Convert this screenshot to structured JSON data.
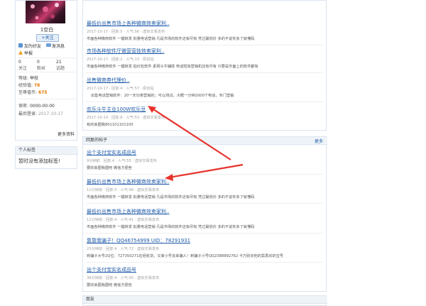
{
  "profile": {
    "username": "1空白",
    "follow_button": "+关注",
    "actions": [
      "加为好友",
      "发消息"
    ],
    "report": "举报",
    "stats": [
      {
        "value": "0",
        "label": "关注"
      },
      {
        "value": "0",
        "label": "粉丝"
      },
      {
        "value": "21",
        "label": "话题"
      }
    ],
    "level_label": "等级:",
    "level_value": "举校",
    "points_label": "经验值:",
    "points_value": "78",
    "money_label": "至尊值币:",
    "money_value": "675",
    "phone_label": "保密:",
    "phone_value": "0000-00-00",
    "last_login_label": "最后登录:",
    "last_login_value": "2017-10-17",
    "more_link": "更多资料"
  },
  "personal_tags": {
    "heading": "个人标签",
    "empty_text": "暂时没有添加标签!"
  },
  "topics": [
    {
      "title": "最低价出售市场上各种微商效卖家利..",
      "meta": "2017-10-17 · 回复:5 · 人气:56 · 虚拟交易发布",
      "summary": "市面各种微商软件 一键转发 批量电话营销 凡是市场的软件这有尽有 凭过最低价 多的不说你多了就懂码"
    },
    {
      "title": "市场各种软件厅微营营技效卖家利..",
      "meta": "2017-10-17 · 回复:2 · 人气:13 · 原创站",
      "summary": "市面各种微商软件 一键转发 拍红包软件 素网斗牛辅助 电话短信营销机应有尽有 只要是市面上的软件都有"
    },
    {
      "title": "出售微商券代理价..",
      "meta": "2017-10-17 · 回复:4 · 人气:57 · 原创站",
      "summary": "出售电话营销软件：20一天功率营销的；可以测试，大概一分钟2000个电话，专门营销"
    },
    {
      "title": "欢乐斗牛主业100W欢乐豆",
      "meta": "2017-10-14 · 回复:8 · 人气:53 · 虚拟交易发布",
      "summary": "有的来圈我801101101100"
    }
  ],
  "replies": {
    "heading": "回复的帖子",
    "more": "更多",
    "items": [
      {
        "title": "出个支付宝实名成品号",
        "meta": "9分钟前 · 回复:4 · 人气:55 · 虚拟交易发布",
        "summary": "要的来圈我圈吧 微信方便些"
      },
      {
        "title": "最低价出售市场上各种微商效卖家利..",
        "meta": "11分钟前 · 回复:5 · 人气:56 · 虚拟交易发布",
        "summary": "市面各种微商软件 一键转发 批量电话营销 凡是市场的软件这有尽有 凭过最低价 多的不说你多了就懂码"
      },
      {
        "title": "最低价出售市场上各种微商效卖家利..",
        "meta": "12分钟前 · 回复:4 · 人气:41 · 虚拟交易发布",
        "summary": "市面各种微商软件 一键转发 批量电话营销 凡是市场的软件这有尽有 凭过最低价 多的不说你多了就懂码"
      },
      {
        "title": "靠靠我骗子！QQ46754999 UID：78291931",
        "meta": "23分钟前 · 回复:4 · 人气:72 · 虚拟交易发布",
        "summary": "到骗子大号2Q位：727350271在经收货，又拿小号去来骗人！到骗子小号QQ2388892762 卡万别买他的需再买的宝号"
      },
      {
        "title": "出个支付宝实名成品号",
        "meta": "38分钟前 · 回复:4 · 人气:55 · 虚拟交易发布",
        "summary": "要的来圈我圈吧 微信方便些"
      }
    ]
  },
  "friends": {
    "heading": "朋友"
  },
  "colors": {
    "link": "#1f5aa8",
    "arrow": "#e8322d",
    "accent": "#e47a00"
  }
}
